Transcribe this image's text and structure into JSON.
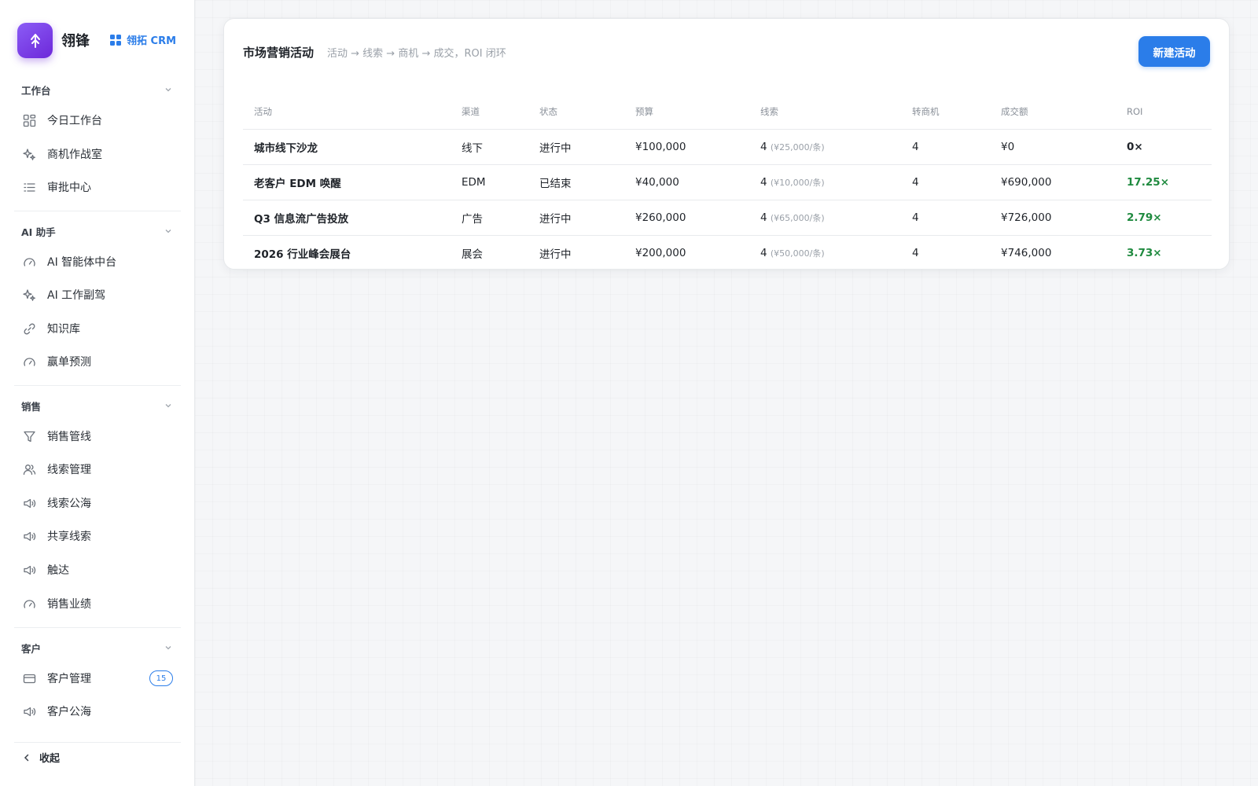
{
  "brand": {
    "name": "翎锋",
    "crm_label": "翎拓 CRM"
  },
  "sidebar": {
    "groups": [
      {
        "title": "工作台",
        "items": [
          {
            "label": "今日工作台",
            "icon": "dashboard-icon"
          },
          {
            "label": "商机作战室",
            "icon": "sparkle-icon"
          },
          {
            "label": "审批中心",
            "icon": "list-icon"
          }
        ]
      },
      {
        "title": "AI 助手",
        "items": [
          {
            "label": "AI 智能体中台",
            "icon": "gauge-icon"
          },
          {
            "label": "AI 工作副驾",
            "icon": "sparkle-icon"
          },
          {
            "label": "知识库",
            "icon": "link-icon"
          },
          {
            "label": "赢单预测",
            "icon": "gauge-icon"
          }
        ]
      },
      {
        "title": "销售",
        "items": [
          {
            "label": "销售管线",
            "icon": "funnel-icon"
          },
          {
            "label": "线索管理",
            "icon": "users-icon"
          },
          {
            "label": "线索公海",
            "icon": "megaphone-icon"
          },
          {
            "label": "共享线索",
            "icon": "megaphone-icon"
          },
          {
            "label": "触达",
            "icon": "megaphone-icon"
          },
          {
            "label": "销售业绩",
            "icon": "gauge-icon"
          }
        ]
      },
      {
        "title": "客户",
        "items": [
          {
            "label": "客户管理",
            "icon": "card-icon",
            "badge": "15"
          },
          {
            "label": "客户公海",
            "icon": "megaphone-icon"
          }
        ]
      }
    ],
    "collapse_label": "收起"
  },
  "page": {
    "title": "市场营销活动",
    "subtitle": "活动 → 线索 → 商机 → 成交，ROI 闭环",
    "new_button": "新建活动"
  },
  "table": {
    "columns": [
      "活动",
      "渠道",
      "状态",
      "预算",
      "线索",
      "转商机",
      "成交额",
      "ROI"
    ],
    "rows": [
      {
        "name": "城市线下沙龙",
        "channel": "线下",
        "status": "进行中",
        "budget": "¥100,000",
        "leads": "4",
        "cost_per_lead": "(¥25,000/条)",
        "opportunities": "4",
        "revenue": "¥0",
        "roi": "0×"
      },
      {
        "name": "老客户 EDM 唤醒",
        "channel": "EDM",
        "status": "已结束",
        "budget": "¥40,000",
        "leads": "4",
        "cost_per_lead": "(¥10,000/条)",
        "opportunities": "4",
        "revenue": "¥690,000",
        "roi": "17.25×"
      },
      {
        "name": "Q3 信息流广告投放",
        "channel": "广告",
        "status": "进行中",
        "budget": "¥260,000",
        "leads": "4",
        "cost_per_lead": "(¥65,000/条)",
        "opportunities": "4",
        "revenue": "¥726,000",
        "roi": "2.79×"
      },
      {
        "name": "2026 行业峰会展台",
        "channel": "展会",
        "status": "进行中",
        "budget": "¥200,000",
        "leads": "4",
        "cost_per_lead": "(¥50,000/条)",
        "opportunities": "4",
        "revenue": "¥746,000",
        "roi": "3.73×"
      }
    ]
  },
  "colors": {
    "accent": "#2b7de9",
    "brand_purple": "#7c3aed",
    "roi_positive": "#1f8a3f"
  }
}
